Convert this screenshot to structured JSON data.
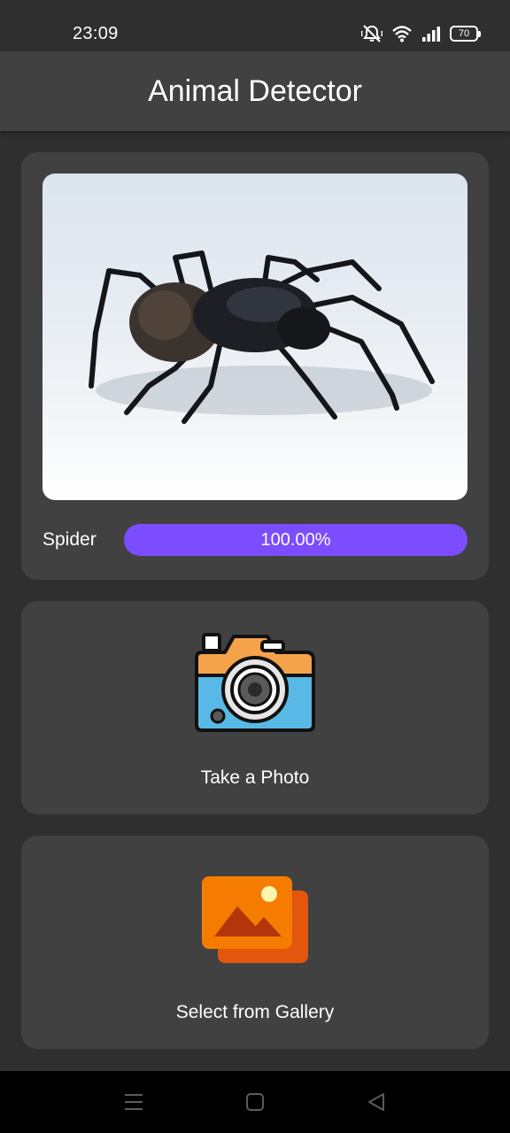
{
  "status_bar": {
    "time": "23:09",
    "battery_level": "70",
    "icons": [
      "bell-off-icon",
      "wifi-icon",
      "signal-icon",
      "battery-icon"
    ]
  },
  "app_bar": {
    "title": "Animal Detector"
  },
  "result": {
    "label": "Spider",
    "confidence_text": "100.00%",
    "confidence_fraction": 1.0,
    "bar_color": "#7c4dff"
  },
  "actions": {
    "camera_label": "Take a Photo",
    "gallery_label": "Select from Gallery"
  },
  "nav": {
    "icons": [
      "menu-icon",
      "home-icon",
      "back-icon"
    ]
  },
  "colors": {
    "background": "#2f2f2f",
    "card": "#414141",
    "accent": "#7c4dff"
  }
}
